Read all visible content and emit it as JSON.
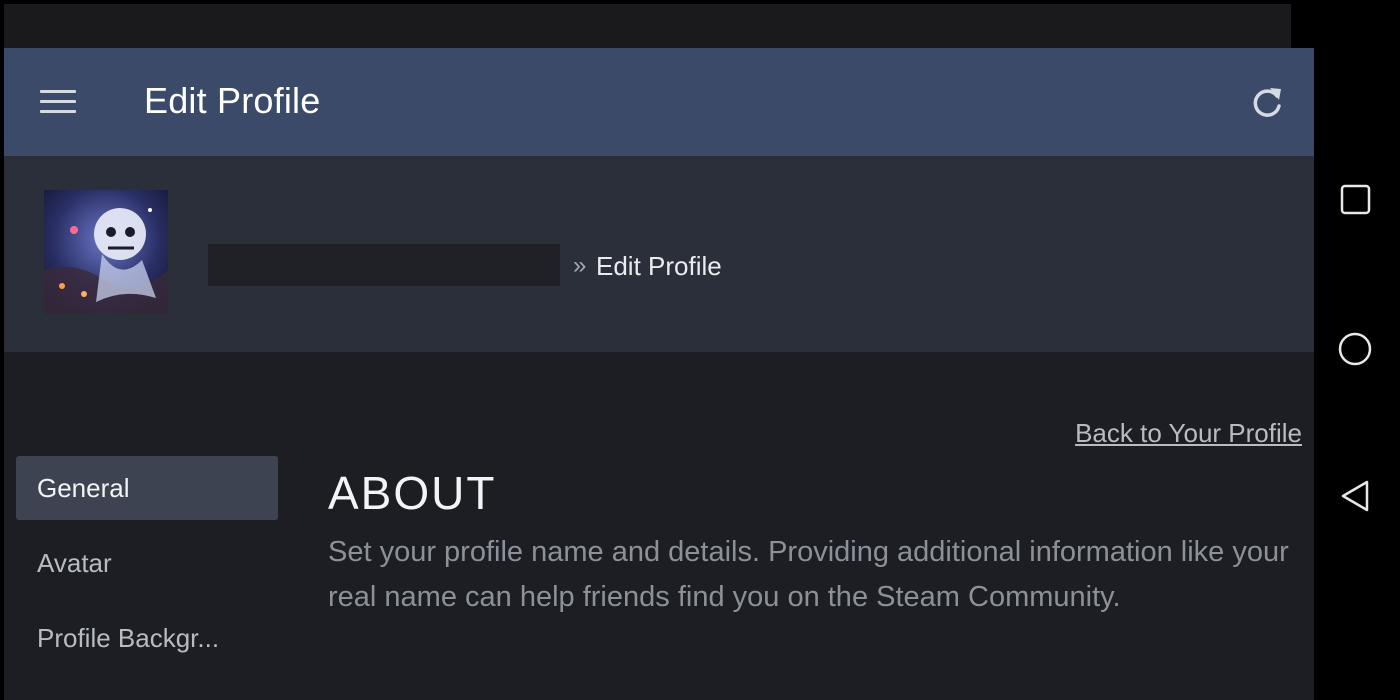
{
  "topbar": {
    "title": "Edit Profile",
    "menu_icon": "hamburger-icon",
    "refresh_icon": "refresh-icon"
  },
  "profile_header": {
    "breadcrumb_separator": "»",
    "breadcrumb_current": "Edit Profile"
  },
  "content": {
    "back_link": "Back to Your Profile",
    "nav": [
      {
        "label": "General",
        "active": true
      },
      {
        "label": "Avatar",
        "active": false
      },
      {
        "label": "Profile Backgr..."
      }
    ],
    "section_title": "ABOUT",
    "section_desc": "Set your profile name and details. Providing additional information like your real name can help friends find you on the Steam Community."
  },
  "android_nav": {
    "recents_icon": "square-icon",
    "home_icon": "circle-icon",
    "back_icon": "triangle-back-icon"
  },
  "colors": {
    "topbar": "#3a4a68",
    "profile_header": "#2b2f39",
    "content_bg": "#1c1e24",
    "nav_active": "#3d4350"
  }
}
